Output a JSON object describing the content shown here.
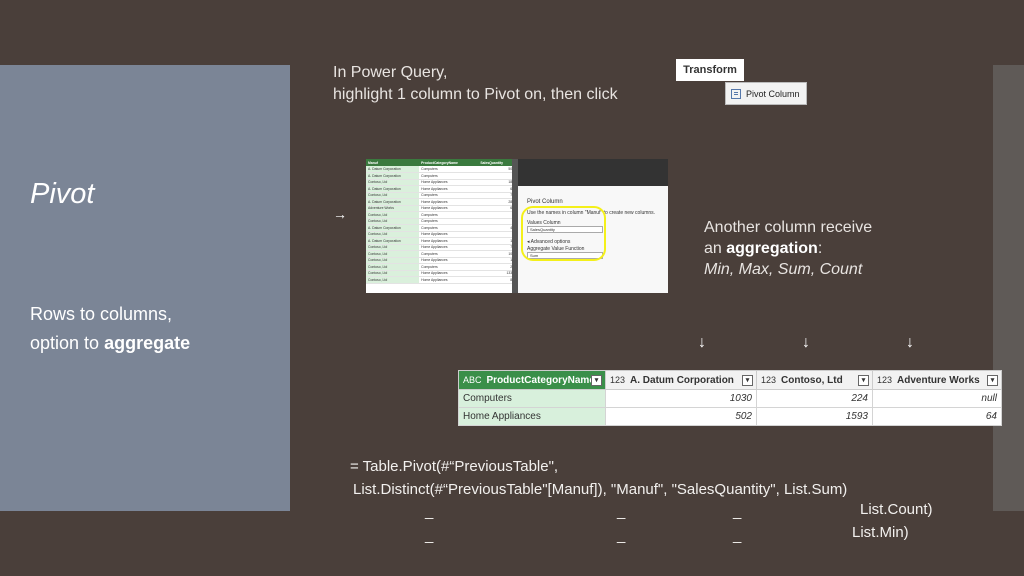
{
  "left": {
    "title": "Pivot",
    "subtitle_line1": "Rows to columns,",
    "subtitle_line2_prefix": "option to ",
    "subtitle_line2_bold": "aggregate"
  },
  "intro": {
    "line1": "In Power Query,",
    "line2": "highlight 1 column to Pivot on, then click"
  },
  "ribbon": {
    "transform_label": "Transform",
    "pivot_column_label": "Pivot Column",
    "pivot_column_icon": "pivot-column-icon"
  },
  "arrow_right": "→",
  "screenshot": {
    "headers": [
      "Manuf",
      "ProductCategoryName",
      "SalesQuantity"
    ],
    "rows": [
      [
        "A. Datum Corporation",
        "Computers",
        "502"
      ],
      [
        "A. Datum Corporation",
        "Computers",
        "8"
      ],
      [
        "Contoso, Ltd",
        "Home Appliances",
        "187"
      ],
      [
        "A. Datum Corporation",
        "Home Appliances",
        "67"
      ],
      [
        "Contoso, Ltd",
        "Computers",
        "78"
      ],
      [
        "A. Datum Corporation",
        "Home Appliances",
        "284"
      ],
      [
        "Adventure Works",
        "Home Appliances",
        "64"
      ],
      [
        "Contoso, Ltd",
        "Computers",
        "4"
      ],
      [
        "Contoso, Ltd",
        "Computers",
        "3"
      ],
      [
        "A. Datum Corporation",
        "Computers",
        "46"
      ],
      [
        "Contoso, Ltd",
        "Home Appliances",
        "5"
      ],
      [
        "A. Datum Corporation",
        "Home Appliances",
        "12"
      ],
      [
        "Contoso, Ltd",
        "Home Appliances",
        "73"
      ],
      [
        "Contoso, Ltd",
        "Computers",
        "104"
      ],
      [
        "Contoso, Ltd",
        "Home Appliances",
        "18"
      ],
      [
        "Contoso, Ltd",
        "Computers",
        "28"
      ],
      [
        "Contoso, Ltd",
        "Home Appliances",
        "1337"
      ],
      [
        "Contoso, Ltd",
        "Home Appliances",
        "80"
      ]
    ],
    "dialog_title": "Pivot Column",
    "dialog_desc": "Use the names in column \"Manuf\" to create new columns.",
    "values_column_label": "Values Column",
    "values_column_value": "SalesQuantity",
    "advanced_label": "◂ Advanced options",
    "agg_label": "Aggregate Value Function",
    "agg_value": "Sum"
  },
  "another": {
    "line1": "Another column receive",
    "line2_prefix": "an ",
    "line2_bold": "aggregation",
    "line2_suffix": ":",
    "line3": "Min, Max, Sum, Count"
  },
  "down_arrow": "↓",
  "result_table": {
    "headers": [
      {
        "type": "ABC",
        "label": "ProductCategoryName"
      },
      {
        "type": "123",
        "label": "A. Datum Corporation"
      },
      {
        "type": "123",
        "label": "Contoso, Ltd"
      },
      {
        "type": "123",
        "label": "Adventure Works"
      }
    ],
    "rows": [
      [
        "Computers",
        "1030",
        "224",
        "null"
      ],
      [
        "Home Appliances",
        "502",
        "1593",
        "64"
      ]
    ],
    "dropdown_icon": "▾"
  },
  "formula": {
    "line1": "= Table.Pivot(#“PreviousTable\",",
    "line2": "List.Distinct(#“PreviousTable\"[Manuf]), \"Manuf\", \"SalesQuantity\", List.Sum)",
    "line3": "List.Count)",
    "line4": "List.Min)",
    "underscore": "_"
  },
  "colors": {
    "background": "#4a3f3a",
    "left_panel": "#7b8596",
    "header_green": "#3a8f49",
    "highlight_yellow": "#f4f01a"
  }
}
